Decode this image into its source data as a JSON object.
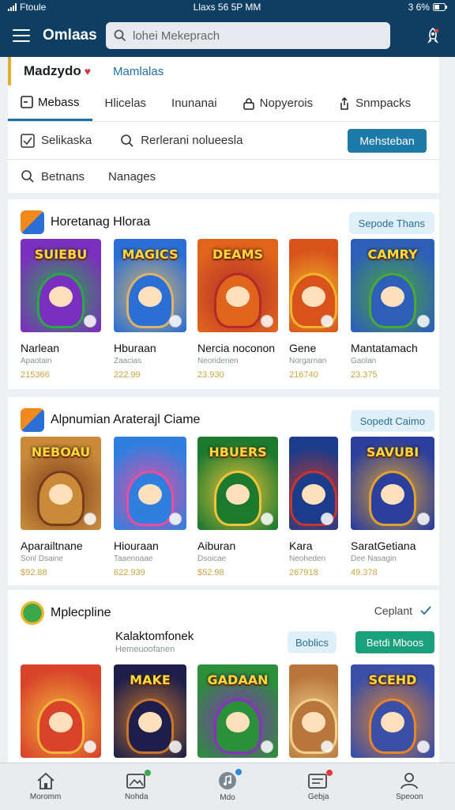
{
  "status_bar": {
    "left": "Ftoule",
    "center": "Llaxs 56 5P MM",
    "right": "3 6%"
  },
  "header": {
    "title": "Omlaas",
    "search_placeholder": "lohei Mekeprach",
    "icon": "rocket-icon"
  },
  "account": {
    "name": "Madzydo",
    "link": "Mamlalas"
  },
  "tabs": [
    {
      "label": "Mebass",
      "icon": "minus-square-icon"
    },
    {
      "label": "Hlicelas",
      "icon": ""
    },
    {
      "label": "Inunanai",
      "icon": ""
    },
    {
      "label": "Nopyerois",
      "icon": "lock-icon"
    },
    {
      "label": "Snmpacks",
      "icon": "share-icon"
    }
  ],
  "filters": {
    "item1": "Selikaska",
    "item2": "Rerlerani nolueesla",
    "button": "Mehsteban"
  },
  "sort": {
    "item1": "Betnans",
    "item2": "Nanages"
  },
  "sections": [
    {
      "title": "Horetanag Hloraa",
      "subtitle": "",
      "pill": "Sepode Thans",
      "games": [
        {
          "art": "SUIEBU",
          "name": "Narlean",
          "sub": "Apaotain",
          "count": "215366",
          "bg": "#7b2fbf",
          "bg2": "#2aa845"
        },
        {
          "art": "MAGICS",
          "name": "Hburaan",
          "sub": "Zaacias",
          "count": "222.99",
          "bg": "#2b6fd6",
          "bg2": "#d9b46a"
        },
        {
          "art": "DEAMS",
          "name": "Nercia noconon",
          "sub": "Neoridenen",
          "count": "23.930",
          "bg": "#e0641c",
          "bg2": "#b22b2b"
        },
        {
          "art": "",
          "name": "Gene",
          "sub": "Norgarnan",
          "count": "216740",
          "bg": "#d8521c",
          "bg2": "#f0b42a"
        },
        {
          "art": "CAMRY",
          "name": "Mantatamach",
          "sub": "Gaolan",
          "count": "23.375",
          "bg": "#2d5fb8",
          "bg2": "#4aa83b"
        }
      ]
    },
    {
      "title": "Alpnumian Araterajl Ciame",
      "subtitle": "",
      "pill": "Sopedt Caimo",
      "games": [
        {
          "art": "NEBOAU",
          "name": "Aparailtnane",
          "sub": "Sonl Dsaine",
          "count": "$92.88",
          "bg": "#c98b3a",
          "bg2": "#7b3c1c"
        },
        {
          "art": "",
          "name": "Hiouraan",
          "sub": "Taaenoaae",
          "count": "622.939",
          "bg": "#2f7fe0",
          "bg2": "#e94ea0"
        },
        {
          "art": "HBUERS",
          "name": "Aiburan",
          "sub": "Dsoicae",
          "count": "$52.98",
          "bg": "#1c7a2f",
          "bg2": "#f0c43a"
        },
        {
          "art": "",
          "name": "Kara",
          "sub": "Neoheden",
          "count": "267918",
          "bg": "#1a3c8a",
          "bg2": "#c7362e"
        },
        {
          "art": "SAVUBI",
          "name": "SaratGetiana",
          "sub": "Dee Nasagin",
          "count": "49.378",
          "bg": "#2b3f9c",
          "bg2": "#e0a030"
        }
      ]
    },
    {
      "title": "Mplecpline",
      "subtitle": "",
      "link": "Ceplant",
      "pill": "Boblics",
      "button": "Betdi Mboos",
      "feature": {
        "name": "Kalaktomfonek",
        "sub": "Hemeuoofanen"
      },
      "games": [
        {
          "art": "",
          "bg": "#d8432a",
          "bg2": "#f2b43a"
        },
        {
          "art": "MAKE",
          "bg": "#1d1f4a",
          "bg2": "#c9762a"
        },
        {
          "art": "GADAAN",
          "bg": "#2c8f3a",
          "bg2": "#8a2fbf"
        },
        {
          "art": "",
          "bg": "#b8763a",
          "bg2": "#f1d08a"
        },
        {
          "art": "SCEHD",
          "bg": "#3a4fa8",
          "bg2": "#e6852a"
        }
      ]
    }
  ],
  "bottom_nav": [
    {
      "label": "Moromm",
      "icon": "home-icon",
      "badge": ""
    },
    {
      "label": "Nohda",
      "icon": "gallery-icon",
      "badge": "#3aa84b"
    },
    {
      "label": "Mdo",
      "icon": "music-icon",
      "badge": "#2b8ad6"
    },
    {
      "label": "Gebja",
      "icon": "inbox-icon",
      "badge": "#e03a3a"
    },
    {
      "label": "Speoon",
      "icon": "user-icon",
      "badge": ""
    }
  ]
}
